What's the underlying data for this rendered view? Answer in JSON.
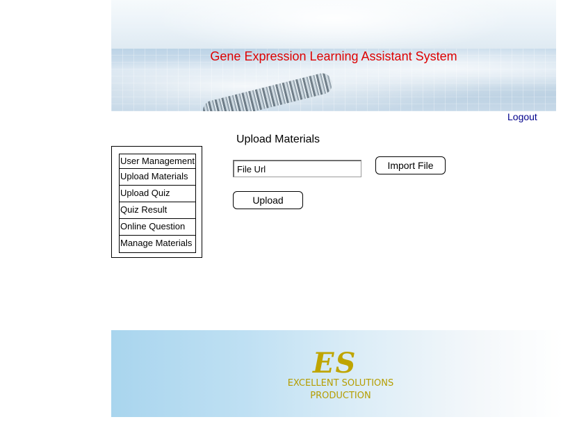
{
  "header": {
    "title": "Gene Expression Learning Assistant System"
  },
  "nav": {
    "logout_label": "Logout"
  },
  "sidebar": {
    "items": [
      {
        "label": "User Management"
      },
      {
        "label": "Upload Materials"
      },
      {
        "label": "Upload Quiz"
      },
      {
        "label": "Quiz Result"
      },
      {
        "label": "Online Question"
      },
      {
        "label": "Manage Materials"
      }
    ]
  },
  "main": {
    "section_title": "Upload Materials",
    "file_url_value": "File Url",
    "import_button_label": "Import File",
    "upload_button_label": "Upload"
  },
  "footer": {
    "logo_mark": "ES",
    "line1": "EXCELLENT SOLUTIONS",
    "line2": "PRODUCTION"
  },
  "colors": {
    "title_red": "#dd0000",
    "link_navy": "#00008b",
    "logo_gold": "#bfa500"
  }
}
